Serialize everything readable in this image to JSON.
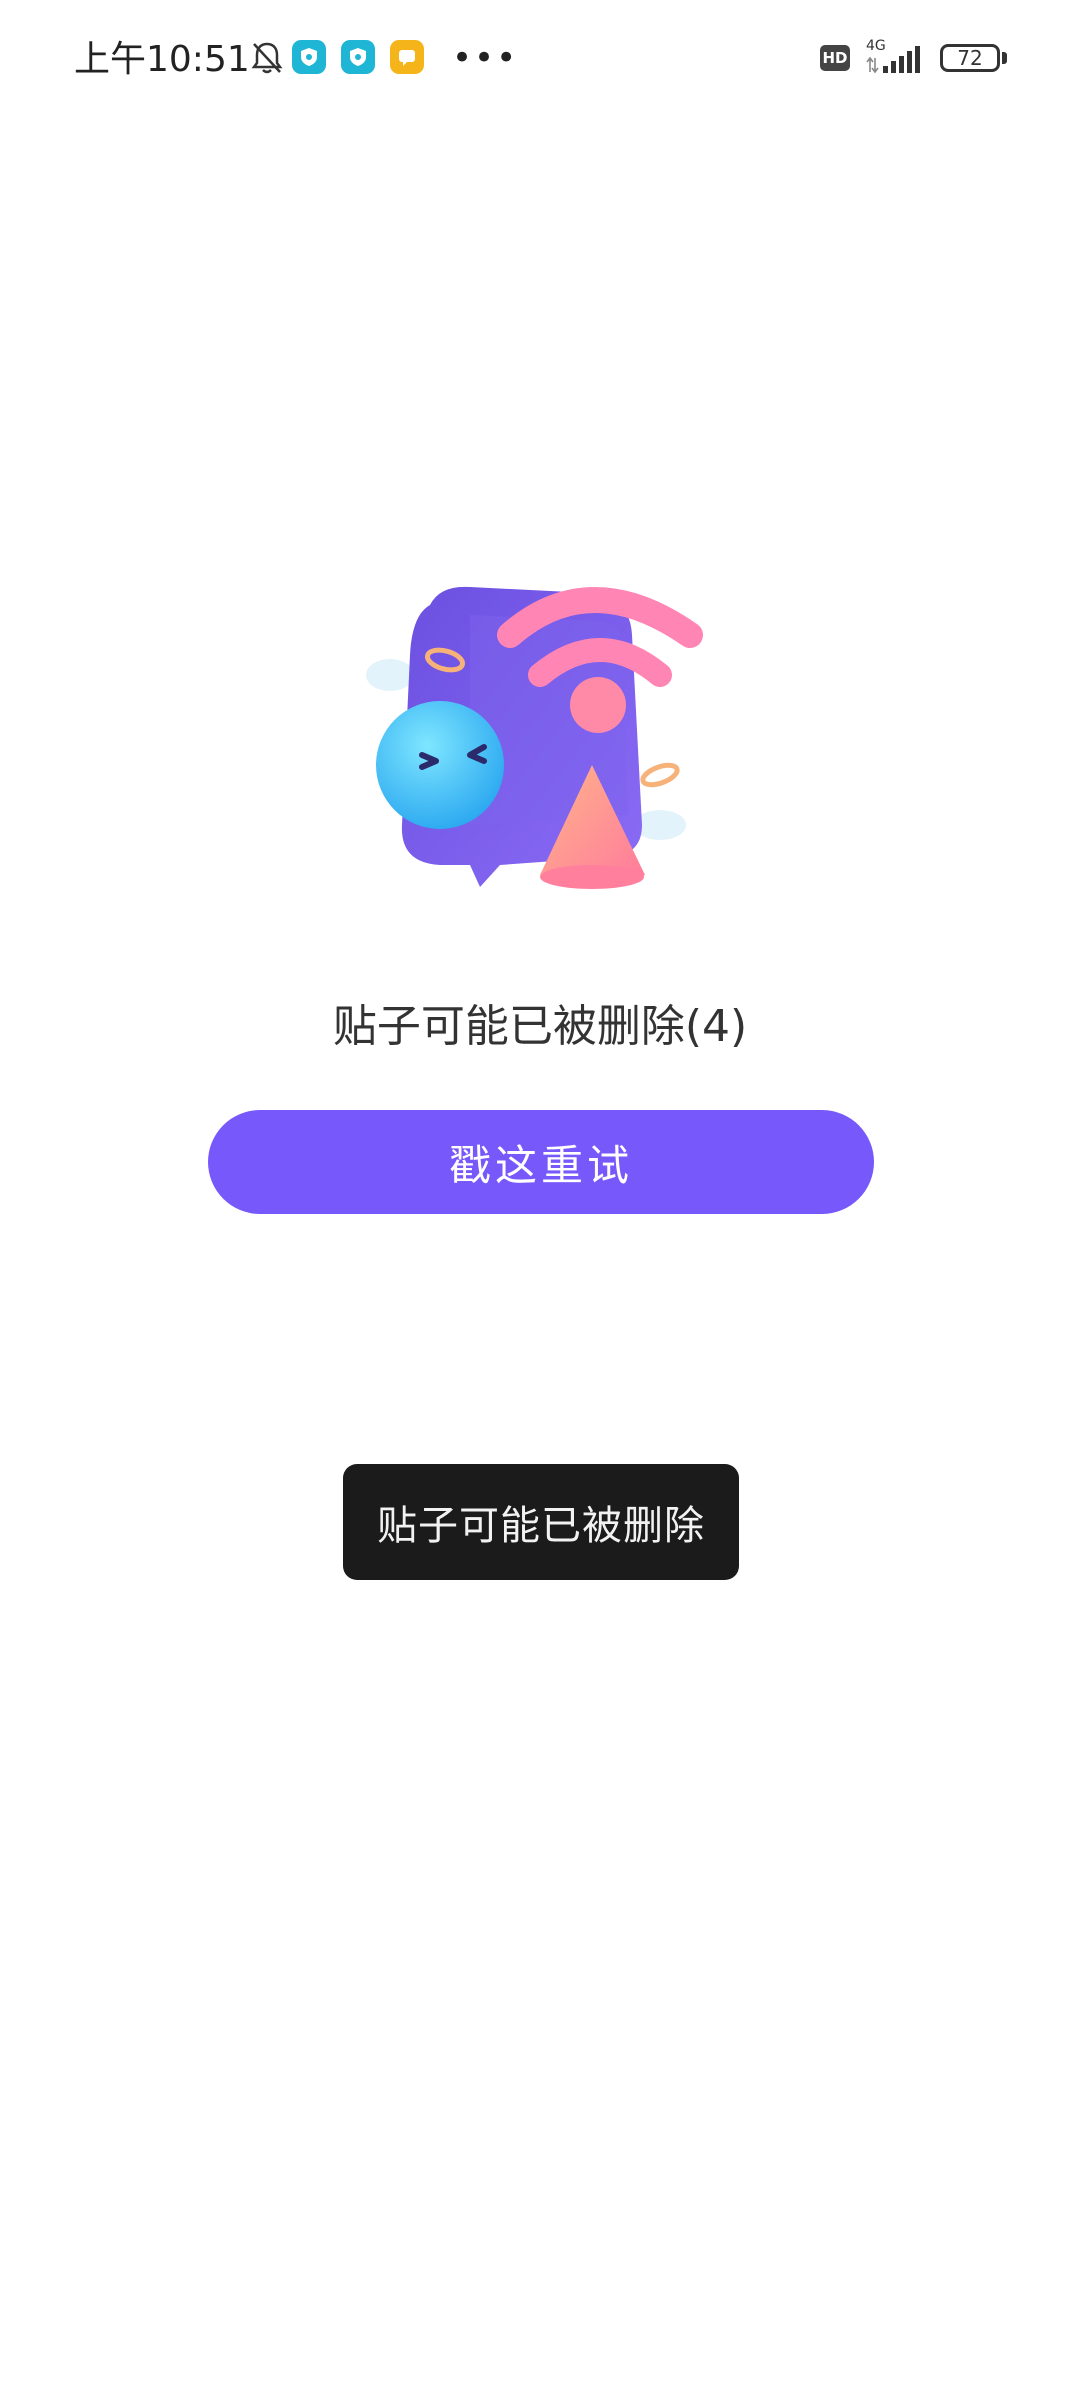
{
  "status_bar": {
    "time": "上午10:51",
    "hd_label": "HD",
    "network_type": "4G",
    "battery": "72",
    "icons": [
      "bell-off-icon",
      "shield-app-icon",
      "shield-app-icon",
      "message-app-icon",
      "more-dots-icon",
      "signal-icon",
      "battery-icon"
    ],
    "more": "•••"
  },
  "main": {
    "error_title": "贴子可能已被删除(4)",
    "retry_label": "戳这重试"
  },
  "toast": {
    "message": "贴子可能已被删除"
  },
  "colors": {
    "accent": "#7758FB",
    "toast_bg": "#1b1b1b",
    "text": "#333333"
  }
}
